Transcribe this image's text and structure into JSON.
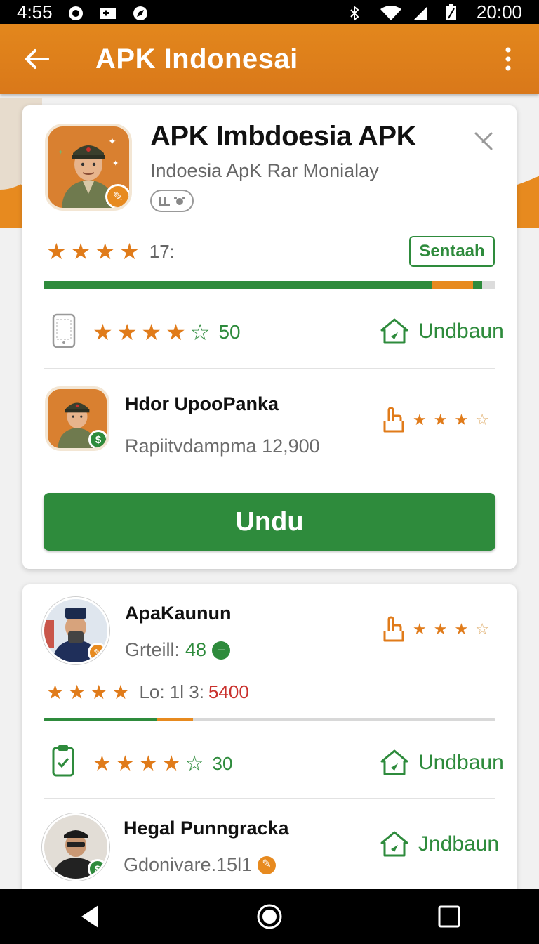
{
  "status_bar": {
    "time": "4:55",
    "clock": "20:00"
  },
  "app_bar": {
    "title": "APK Indonesai"
  },
  "colors": {
    "primary": "#2e8b3c",
    "accent": "#e78a1f",
    "app_bar": "#e3871c"
  },
  "featured": {
    "title": "APK Imbdoesia APK",
    "subtitle": "Indoesia ApK Rar Monialay",
    "rating_text": "17:",
    "stars": 4,
    "tag_button": "Sentaah",
    "progress": 0.86,
    "stats_row": {
      "icon": "phone-icon",
      "stars": 4,
      "count": "50",
      "link": "Undbaun"
    },
    "sub_item": {
      "name": "Hdor UpooPanka",
      "meta": "Rapiitvdampma 12,900",
      "stars": 3
    },
    "primary_button": "Undu"
  },
  "list": {
    "item1": {
      "name": "ApaKaunun",
      "meta_label": "Grteill:",
      "meta_value": "48",
      "rating_text": "Lo: 1l 3:",
      "rating_value": "5400",
      "stars": 4,
      "progress": 0.33,
      "sub_stars": 3
    },
    "stats_row": {
      "icon": "clipboard-icon",
      "stars": 4,
      "count": "30",
      "link": "Undbaun"
    },
    "item2": {
      "name": "Hegal Punngracka",
      "meta": "Gdonivare.15l1",
      "link": "Jndbaun"
    }
  }
}
